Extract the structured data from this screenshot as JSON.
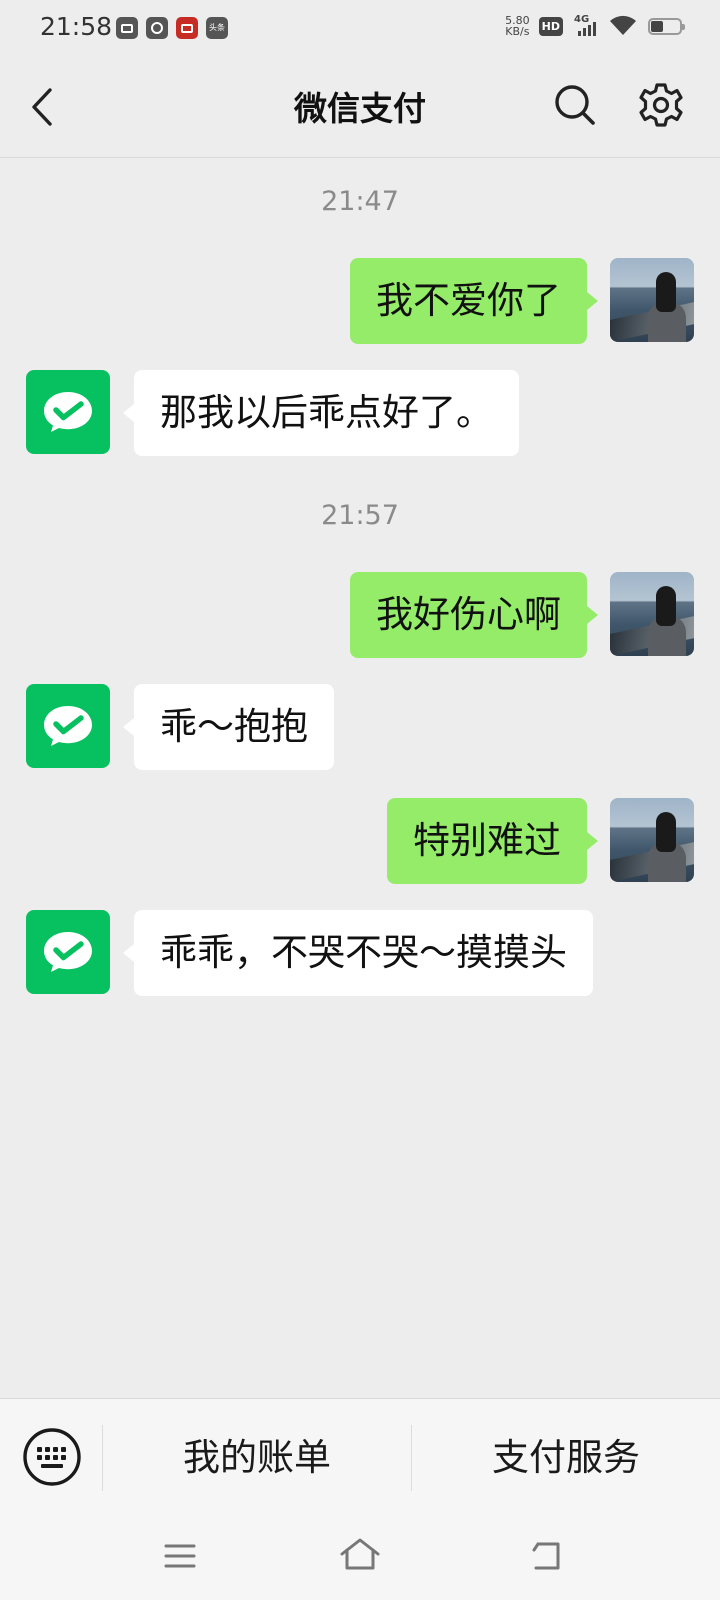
{
  "status_bar": {
    "time": "21:58",
    "net_speed_value": "5.80",
    "net_speed_unit": "KB/s",
    "hd_label": "HD",
    "network_type": "4G",
    "app_icons": [
      "screenshot-app-icon",
      "speedometer-app-icon",
      "red-app-icon",
      "toutiao-app-icon"
    ],
    "toutiao_label": "头条"
  },
  "header": {
    "title": "微信支付"
  },
  "chat": {
    "timestamps": [
      "21:47",
      "21:57"
    ],
    "messages": [
      {
        "direction": "out",
        "text": "我不爱你了"
      },
      {
        "direction": "in",
        "text": "那我以后乖点好了。"
      },
      {
        "direction": "out",
        "text": "我好伤心啊"
      },
      {
        "direction": "in",
        "text": "乖～抱抱"
      },
      {
        "direction": "out",
        "text": "特别难过"
      },
      {
        "direction": "in",
        "text": "乖乖，不哭不哭～摸摸头"
      }
    ]
  },
  "menu": {
    "items": [
      "我的账单",
      "支付服务"
    ]
  },
  "colors": {
    "background": "#ededed",
    "outgoing_bubble": "#95ec69",
    "incoming_bubble": "#ffffff",
    "wechat_green": "#07c160",
    "timestamp_text": "#8a8a8a"
  }
}
